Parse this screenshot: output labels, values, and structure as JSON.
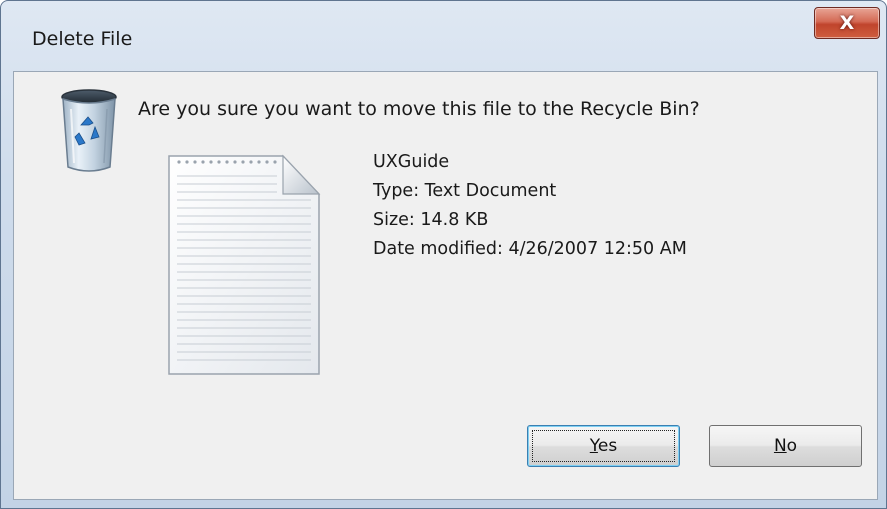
{
  "window": {
    "title": "Delete File",
    "close_glyph": "X"
  },
  "dialog": {
    "question": "Are you sure you want to move this file to the Recycle Bin?",
    "icon": "recycle-bin-icon",
    "file": {
      "icon": "text-document-icon",
      "name": "UXGuide",
      "type": "Type: Text Document",
      "size": "Size: 14.8 KB",
      "modified": "Date modified: 4/26/2007 12:50 AM"
    }
  },
  "buttons": {
    "yes": {
      "accel": "Y",
      "rest": "es"
    },
    "no": {
      "accel": "N",
      "rest": "o"
    }
  },
  "colors": {
    "close_button": "#c0442c",
    "default_button_border": "#3c7fb1"
  }
}
